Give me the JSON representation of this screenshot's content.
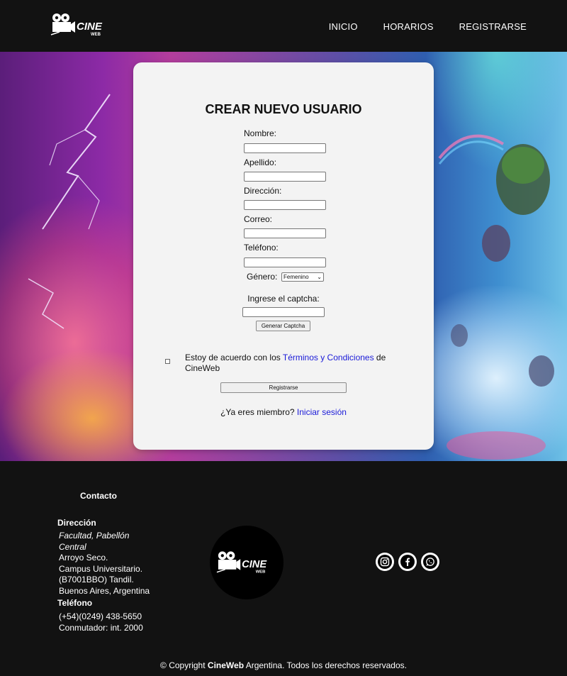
{
  "header": {
    "logo_text": "CINE",
    "logo_subtext": "WEB",
    "nav": [
      "INICIO",
      "HORARIOS",
      "REGISTRARSE"
    ]
  },
  "form": {
    "title": "CREAR NUEVO USUARIO",
    "fields": [
      {
        "label": "Nombre:",
        "value": ""
      },
      {
        "label": "Apellido:",
        "value": ""
      },
      {
        "label": "Dirección:",
        "value": ""
      },
      {
        "label": "Correo:",
        "value": ""
      },
      {
        "label": "Teléfono:",
        "value": ""
      }
    ],
    "genero_label": "Género:",
    "genero_selected": "Femenino",
    "captcha_label": "Ingrese el captcha:",
    "captcha_value": "",
    "captcha_button": "Generar Captcha",
    "terms_prefix": "Estoy de acuerdo con los ",
    "terms_link": "Términos y Condiciones",
    "terms_suffix": " de CineWeb",
    "terms_checked": false,
    "register_button": "Registrarse",
    "member_text": "¿Ya eres miembro? ",
    "login_link": "Iniciar sesión"
  },
  "footer": {
    "contacto": "Contacto",
    "direccion_title": "Dirección",
    "address_italic": "Facultad, Pabellón Central",
    "address_lines": [
      "Arroyo Seco.",
      "Campus Universitario.",
      "(B7001BBO) Tandil.",
      "Buenos Aires, Argentina"
    ],
    "telefono_title": "Teléfono",
    "phone_lines": [
      "(+54)(0249) 438-5650",
      "Conmutador: int. 2000"
    ],
    "socials": [
      "instagram-icon",
      "facebook-icon",
      "whatsapp-icon"
    ],
    "copyright_prefix": "© Copyright ",
    "copyright_brand": "CineWeb",
    "copyright_suffix": " Argentina. Todos los derechos reservados."
  },
  "colors": {
    "header_bg": "#121212",
    "card_bg": "#f3f3f3",
    "link": "#1a1ad8"
  }
}
